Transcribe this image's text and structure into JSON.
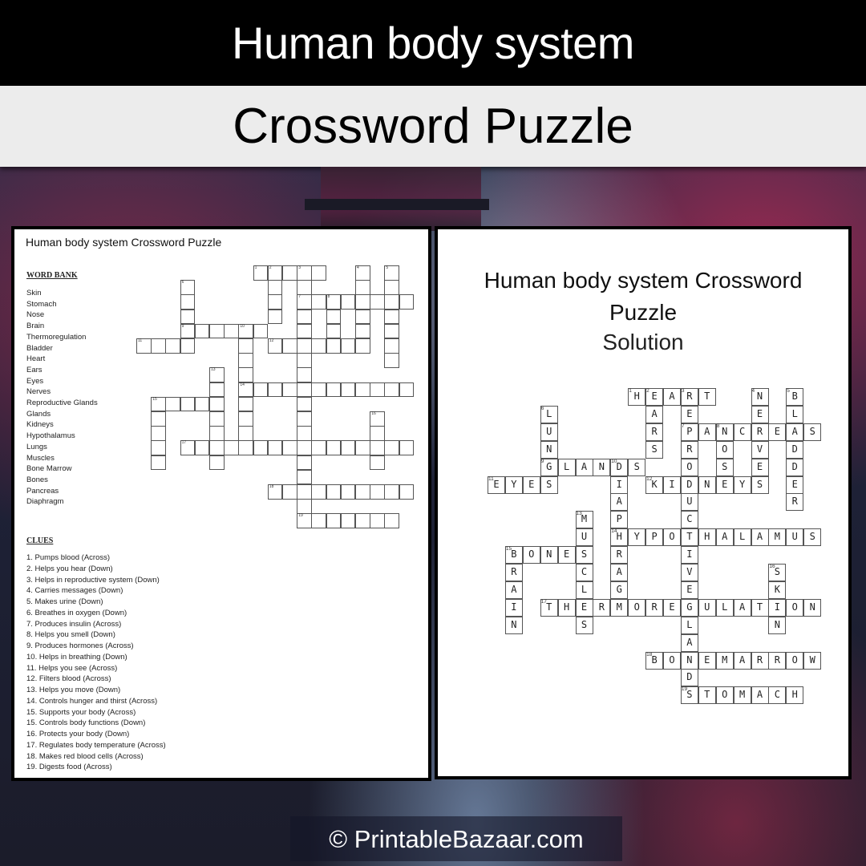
{
  "header": {
    "title": "Human body system",
    "subtitle": "Crossword Puzzle"
  },
  "puzzle_sheet": {
    "title": "Human body system Crossword Puzzle",
    "word_bank_heading": "WORD BANK",
    "word_bank": [
      "Skin",
      "Stomach",
      "Nose",
      "Brain",
      "Thermoregulation",
      "Bladder",
      "Heart",
      "Ears",
      "Eyes",
      "Nerves",
      "Reproductive Glands",
      "Glands",
      "Kidneys",
      "Hypothalamus",
      "Lungs",
      "Muscles",
      "Bone Marrow",
      "Bones",
      "Pancreas",
      "Diaphragm"
    ],
    "clues_heading": "CLUES",
    "clues": [
      "1. Pumps blood (Across)",
      "2. Helps you hear (Down)",
      "3. Helps in reproductive  system (Down)",
      "4. Carries messages (Down)",
      "5. Makes urine (Down)",
      "6. Breathes in oxygen (Down)",
      "7. Produces insulin (Across)",
      "8. Helps you smell (Down)",
      "9. Produces hormones  (Across)",
      "10. Helps in breathing (Down)",
      "11. Helps you see (Across)",
      "12. Filters blood (Across)",
      "13. Helps you move  (Down)",
      "14. Controls hunger and thirst (Across)",
      "15. Supports  your body (Across)",
      "15. Controls body functions (Down)",
      "16. Protects your body (Down)",
      "17. Regulates body temperature  (Across)",
      "18. Makes red blood cells (Across)",
      "19. Digests food (Across)"
    ]
  },
  "solution_sheet": {
    "title_line1": "Human body system Crossword",
    "title_line2": "Puzzle",
    "subtitle": "Solution"
  },
  "crossword": {
    "cols": 19,
    "rows": 18,
    "entries": [
      {
        "num": 1,
        "dir": "across",
        "row": 0,
        "col": 8,
        "answer": "HEART"
      },
      {
        "num": 2,
        "dir": "down",
        "row": 0,
        "col": 9,
        "answer": "EARS"
      },
      {
        "num": 3,
        "dir": "down",
        "row": 0,
        "col": 11,
        "answer": "REPRODUCTIVEGLANDS"
      },
      {
        "num": 4,
        "dir": "down",
        "row": 0,
        "col": 15,
        "answer": "NERVES"
      },
      {
        "num": 5,
        "dir": "down",
        "row": 0,
        "col": 17,
        "answer": "BLADDER"
      },
      {
        "num": 6,
        "dir": "down",
        "row": 1,
        "col": 3,
        "answer": "LUNGS"
      },
      {
        "num": 7,
        "dir": "across",
        "row": 2,
        "col": 11,
        "answer": "PANCREAS"
      },
      {
        "num": 8,
        "dir": "down",
        "row": 2,
        "col": 13,
        "answer": "NOSE"
      },
      {
        "num": 9,
        "dir": "across",
        "row": 4,
        "col": 3,
        "answer": "GLANDS"
      },
      {
        "num": 10,
        "dir": "down",
        "row": 4,
        "col": 7,
        "answer": "DIAPHRAGM"
      },
      {
        "num": 11,
        "dir": "across",
        "row": 5,
        "col": 0,
        "answer": "EYES"
      },
      {
        "num": 12,
        "dir": "across",
        "row": 5,
        "col": 9,
        "answer": "KIDNEYS"
      },
      {
        "num": 13,
        "dir": "down",
        "row": 7,
        "col": 5,
        "answer": "MUSCLES"
      },
      {
        "num": 14,
        "dir": "across",
        "row": 8,
        "col": 7,
        "answer": "HYPOTHALAMUS"
      },
      {
        "num": 15,
        "dir": "across",
        "row": 9,
        "col": 1,
        "answer": "BONES"
      },
      {
        "num": 15,
        "dir": "down",
        "row": 9,
        "col": 1,
        "answer": "BRAIN"
      },
      {
        "num": 16,
        "dir": "down",
        "row": 10,
        "col": 16,
        "answer": "SKIN"
      },
      {
        "num": 17,
        "dir": "across",
        "row": 12,
        "col": 3,
        "answer": "THERMOREGULATION"
      },
      {
        "num": 18,
        "dir": "across",
        "row": 15,
        "col": 9,
        "answer": "BONEMARROW"
      },
      {
        "num": 19,
        "dir": "across",
        "row": 17,
        "col": 11,
        "answer": "STOMACH"
      }
    ]
  },
  "footer": {
    "text": "© PrintableBazaar.com"
  }
}
